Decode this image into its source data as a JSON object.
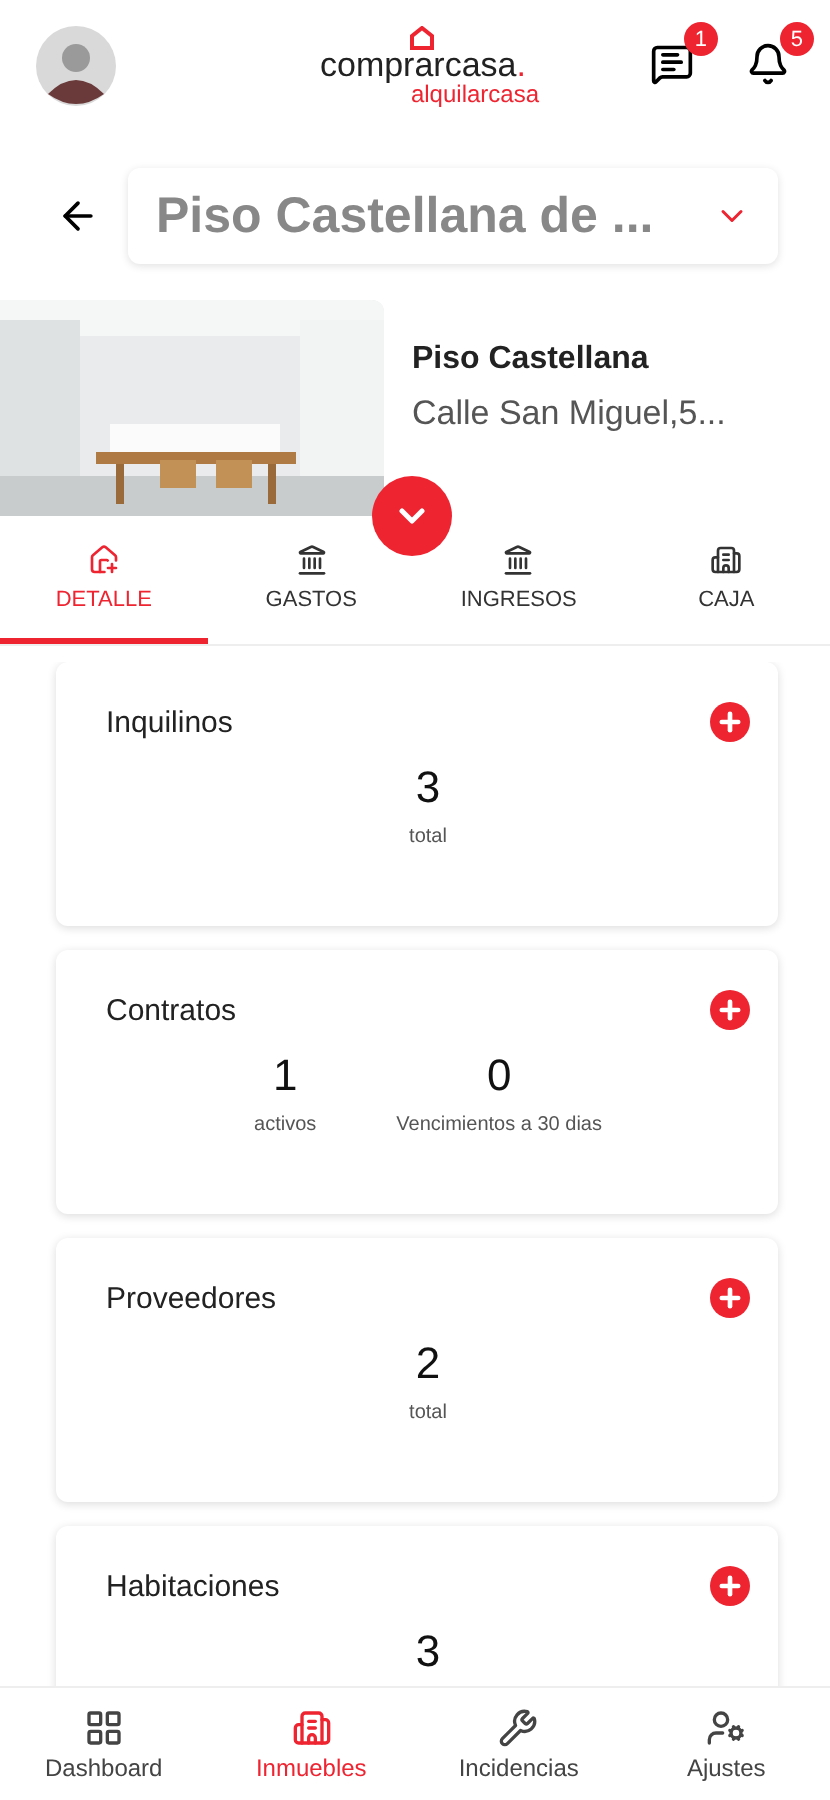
{
  "header": {
    "logo_top": "comprarcasa",
    "logo_dot": ".",
    "logo_bottom": "alquilarcasa",
    "messages_badge": "1",
    "notifications_badge": "5"
  },
  "property_select": {
    "value": "Piso Castellana de ..."
  },
  "property": {
    "name": "Piso Castellana",
    "address": "Calle San Miguel,5..."
  },
  "tabs": [
    {
      "label": "DETALLE",
      "selected": true
    },
    {
      "label": "GASTOS",
      "selected": false
    },
    {
      "label": "INGRESOS",
      "selected": false
    },
    {
      "label": "CAJA",
      "selected": false
    }
  ],
  "cards": [
    {
      "title": "Inquilinos",
      "stats": [
        {
          "value": "3",
          "label": "total"
        }
      ]
    },
    {
      "title": "Contratos",
      "stats": [
        {
          "value": "1",
          "label": "activos"
        },
        {
          "value": "0",
          "label": "Vencimientos a 30 dias"
        }
      ]
    },
    {
      "title": "Proveedores",
      "stats": [
        {
          "value": "2",
          "label": "total"
        }
      ]
    },
    {
      "title": "Habitaciones",
      "stats": [
        {
          "value": "3"
        }
      ]
    }
  ],
  "bottom_nav": [
    {
      "label": "Dashboard",
      "selected": false
    },
    {
      "label": "Inmuebles",
      "selected": true
    },
    {
      "label": "Incidencias",
      "selected": false
    },
    {
      "label": "Ajustes",
      "selected": false
    }
  ]
}
